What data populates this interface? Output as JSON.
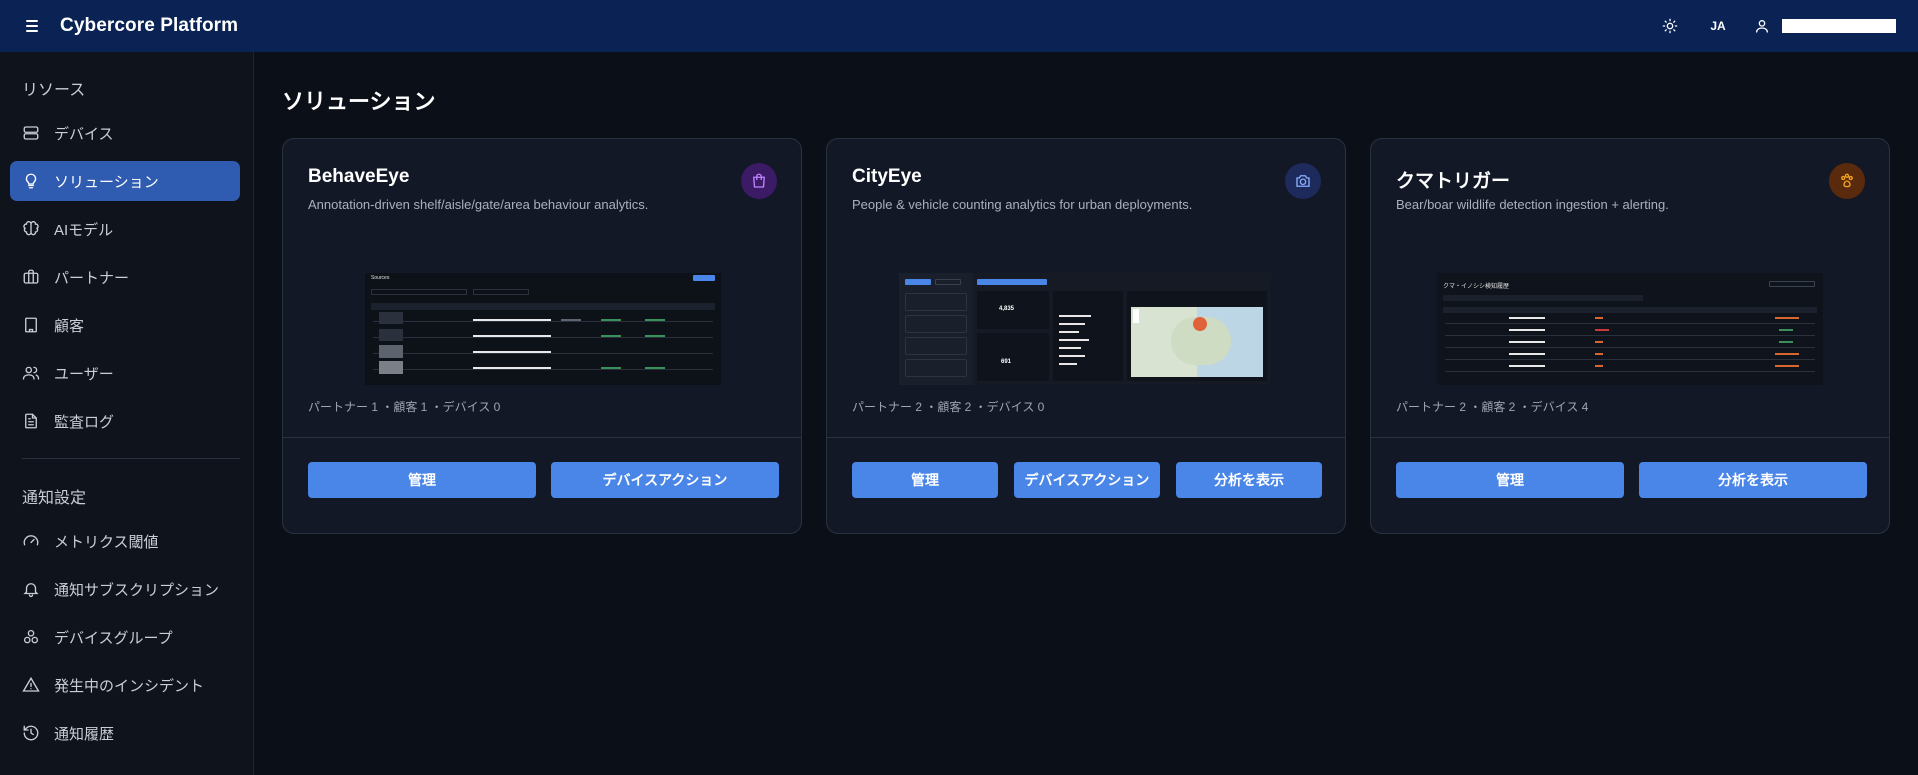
{
  "header": {
    "app_title": "Cybercore Platform",
    "lang": "JA",
    "icons": [
      "menu-icon",
      "sun-icon",
      "user-icon"
    ]
  },
  "sidebar": {
    "resources_label": "リソース",
    "resources": [
      {
        "label": "デバイス",
        "icon": "server-icon"
      },
      {
        "label": "ソリューション",
        "icon": "lightbulb-icon",
        "active": true
      },
      {
        "label": "AIモデル",
        "icon": "brain-icon"
      },
      {
        "label": "パートナー",
        "icon": "briefcase-icon"
      },
      {
        "label": "顧客",
        "icon": "building-icon"
      },
      {
        "label": "ユーザー",
        "icon": "users-icon"
      },
      {
        "label": "監査ログ",
        "icon": "document-icon"
      }
    ],
    "notifications_label": "通知設定",
    "notifications": [
      {
        "label": "メトリクス閾値",
        "icon": "gauge-icon"
      },
      {
        "label": "通知サブスクリプション",
        "icon": "bell-icon"
      },
      {
        "label": "デバイスグループ",
        "icon": "group-icon"
      },
      {
        "label": "発生中のインシデント",
        "icon": "warning-icon"
      },
      {
        "label": "通知履歴",
        "icon": "history-icon"
      }
    ]
  },
  "main": {
    "page_title": "ソリューション",
    "cards": [
      {
        "title": "BehaveEye",
        "description": "Annotation-driven shelf/aisle/gate/area behaviour analytics.",
        "badge_icon": "shopping-bag-icon",
        "badge_color": "#3b1a66",
        "stats": "パートナー 1 ・顧客 1 ・デバイス 0",
        "buttons": [
          "管理",
          "デバイスアクション"
        ],
        "preview": {
          "heading": "Sources"
        }
      },
      {
        "title": "CityEye",
        "description": "People & vehicle counting analytics for urban deployments.",
        "badge_icon": "camera-icon",
        "badge_color": "#1f2a5c",
        "stats": "パートナー 2 ・顧客 2 ・デバイス 0",
        "buttons": [
          "管理",
          "デバイスアクション",
          "分析を表示"
        ],
        "preview": {
          "values": [
            "4,835",
            "691"
          ]
        }
      },
      {
        "title": "クマトリガー",
        "description": "Bear/boar wildlife detection ingestion + alerting.",
        "badge_icon": "paw-icon",
        "badge_color": "#5a2a0c",
        "stats": "パートナー 2 ・顧客 2 ・デバイス 4",
        "buttons": [
          "管理",
          "分析を表示"
        ],
        "preview": {
          "heading": "クマ・イノシシ検知履歴"
        }
      }
    ]
  },
  "colors": {
    "topbar": "#0a2254",
    "accent": "#4a86e8",
    "active_nav": "#2f5cb0",
    "background": "#0b0f17",
    "card": "#121826"
  }
}
